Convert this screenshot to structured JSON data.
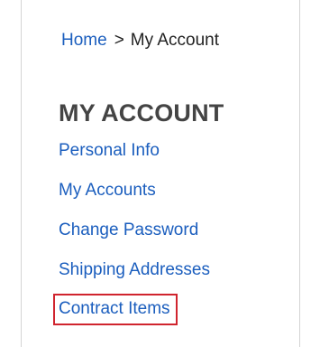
{
  "breadcrumb": {
    "home": "Home",
    "separator": ">",
    "current": "My Account"
  },
  "section": {
    "title": "MY ACCOUNT"
  },
  "menu": {
    "items": [
      {
        "label": "Personal Info"
      },
      {
        "label": "My Accounts"
      },
      {
        "label": "Change Password"
      },
      {
        "label": "Shipping Addresses"
      },
      {
        "label": "Contract Items",
        "highlighted": true
      }
    ]
  },
  "colors": {
    "link": "#1b5ebe",
    "title": "#444444",
    "highlight_border": "#d0242e",
    "panel_border": "#d4d4d4"
  }
}
